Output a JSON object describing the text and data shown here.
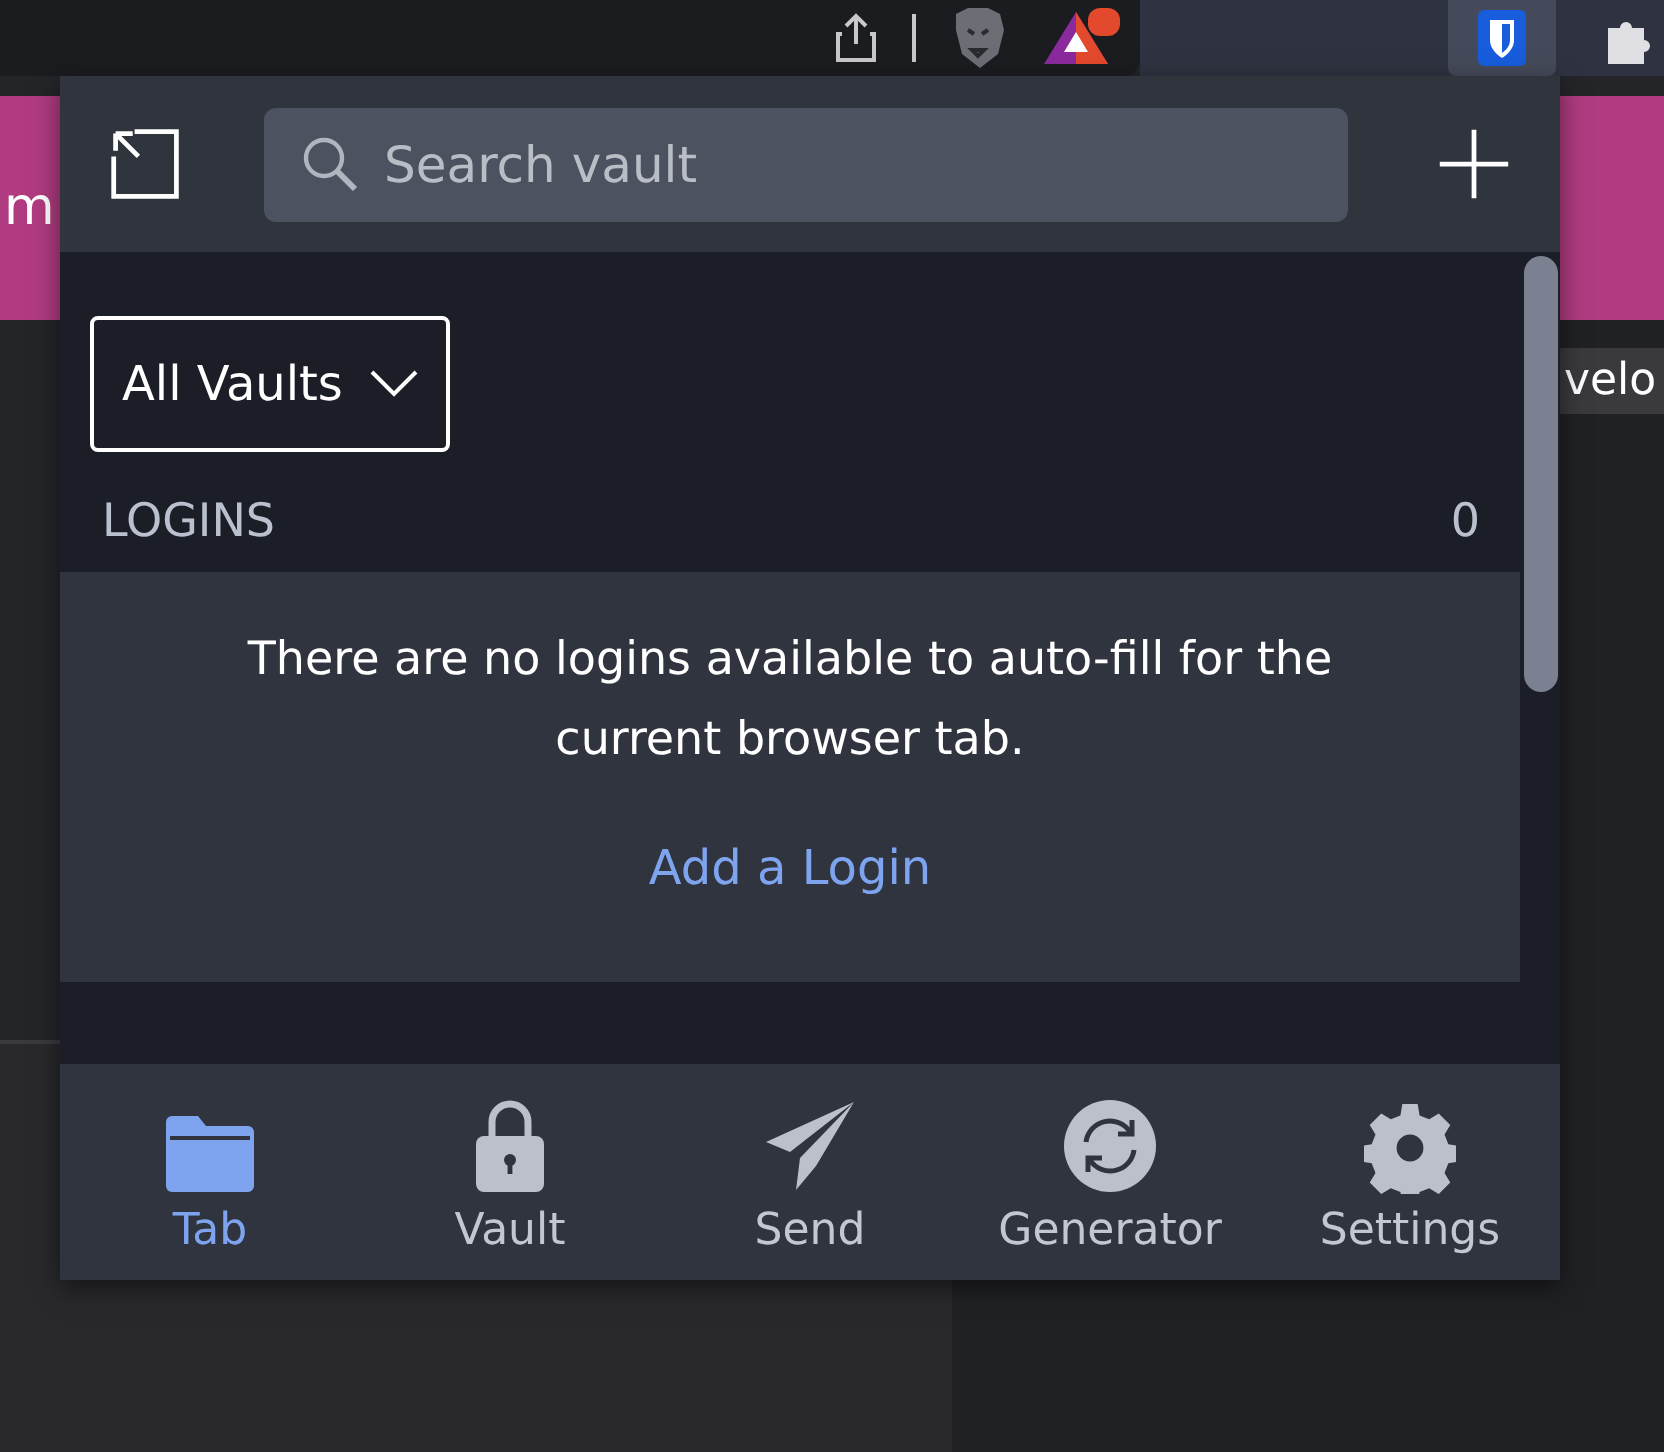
{
  "page_behind": {
    "left_text": "m",
    "right_text": "velo"
  },
  "header": {
    "search": {
      "placeholder": "Search vault"
    }
  },
  "vault_filter": {
    "label": "All Vaults"
  },
  "section": {
    "title": "LOGINS",
    "count": "0"
  },
  "empty_state": {
    "message": "There are no logins available to auto-fill for the current browser tab.",
    "link": "Add a Login"
  },
  "nav": [
    {
      "label": "Tab",
      "kind": "folder",
      "selected": true
    },
    {
      "label": "Vault",
      "kind": "lock",
      "selected": false
    },
    {
      "label": "Send",
      "kind": "send",
      "selected": false
    },
    {
      "label": "Generator",
      "kind": "generator",
      "selected": false
    },
    {
      "label": "Settings",
      "kind": "settings",
      "selected": false
    }
  ]
}
